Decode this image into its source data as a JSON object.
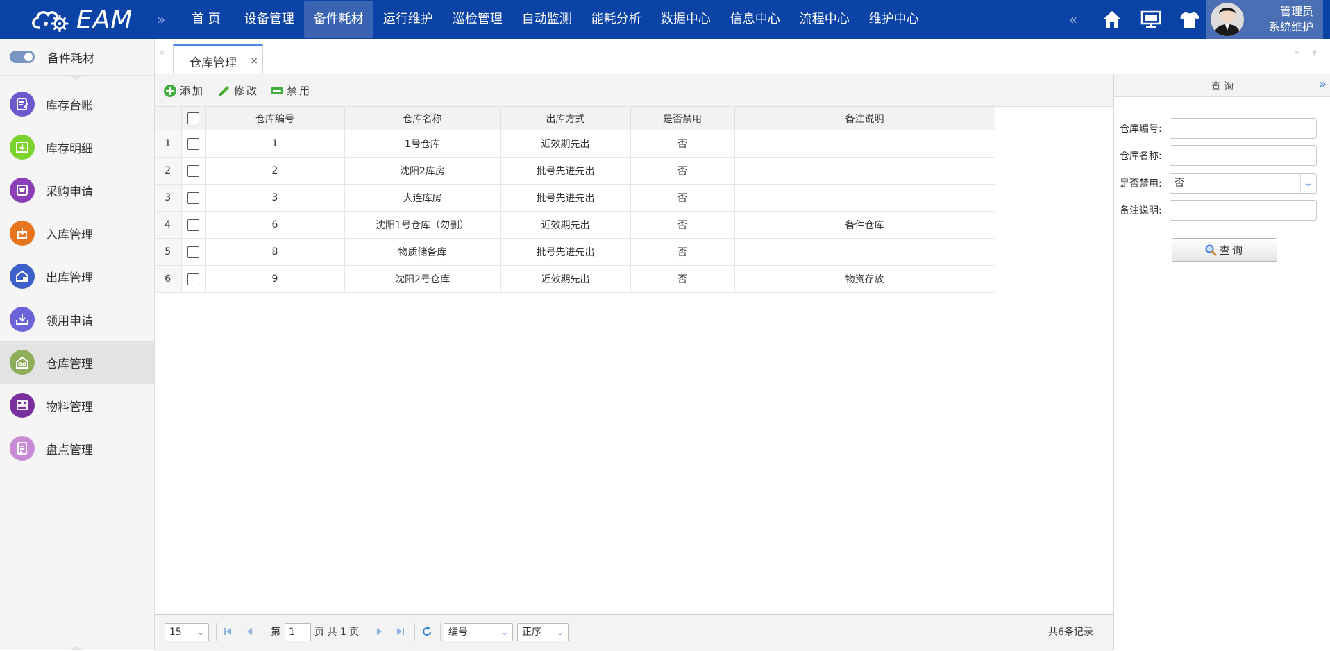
{
  "app": {
    "logo_text": "EAM"
  },
  "nav": {
    "items": [
      {
        "label": "首 页"
      },
      {
        "label": "设备管理"
      },
      {
        "label": "备件耗材",
        "active": true
      },
      {
        "label": "运行维护"
      },
      {
        "label": "巡检管理"
      },
      {
        "label": "自动监测"
      },
      {
        "label": "能耗分析"
      },
      {
        "label": "数据中心"
      },
      {
        "label": "信息中心"
      },
      {
        "label": "流程中心"
      },
      {
        "label": "维护中心"
      }
    ],
    "icons": [
      "home-icon",
      "monitor-icon",
      "tshirt-icon"
    ]
  },
  "user": {
    "name": "管理员",
    "role": "系统维护"
  },
  "sidebar": {
    "title": "备件耗材",
    "items": [
      {
        "label": "库存台账",
        "icon": "ledger-icon",
        "color": "#6a5acd"
      },
      {
        "label": "库存明细",
        "icon": "inventory-detail-icon",
        "color": "#7cd32e"
      },
      {
        "label": "采购申请",
        "icon": "purchase-icon",
        "color": "#8a3fb8"
      },
      {
        "label": "入库管理",
        "icon": "stock-in-icon",
        "color": "#e8741e"
      },
      {
        "label": "出库管理",
        "icon": "stock-out-icon",
        "color": "#3d5fc9"
      },
      {
        "label": "领用申请",
        "icon": "requisition-icon",
        "color": "#6c63d8"
      },
      {
        "label": "仓库管理",
        "icon": "warehouse-icon",
        "color": "#8fae5a",
        "active": true
      },
      {
        "label": "物料管理",
        "icon": "material-icon",
        "color": "#7a2f9e"
      },
      {
        "label": "盘点管理",
        "icon": "stocktake-icon",
        "color": "#c98ad6"
      }
    ]
  },
  "tabs": [
    {
      "label": "仓库管理",
      "close": "×"
    }
  ],
  "toolbar": {
    "add": "添加",
    "edit": "修改",
    "disable": "禁用"
  },
  "grid": {
    "columns": [
      "仓库编号",
      "仓库名称",
      "出库方式",
      "是否禁用",
      "备注说明"
    ],
    "rows": [
      {
        "n": "1",
        "code": "1",
        "name": "1号仓库",
        "method": "近效期先出",
        "disabled": "否",
        "remark": ""
      },
      {
        "n": "2",
        "code": "2",
        "name": "沈阳2库房",
        "method": "批号先进先出",
        "disabled": "否",
        "remark": ""
      },
      {
        "n": "3",
        "code": "3",
        "name": "大连库房",
        "method": "批号先进先出",
        "disabled": "否",
        "remark": ""
      },
      {
        "n": "4",
        "code": "6",
        "name": "沈阳1号仓库（勿删）",
        "method": "近效期先出",
        "disabled": "否",
        "remark": "备件仓库"
      },
      {
        "n": "5",
        "code": "8",
        "name": "物质储备库",
        "method": "批号先进先出",
        "disabled": "否",
        "remark": ""
      },
      {
        "n": "6",
        "code": "9",
        "name": "沈阳2号仓库",
        "method": "近效期先出",
        "disabled": "否",
        "remark": "物资存放"
      }
    ]
  },
  "pager": {
    "page_size": "15",
    "page_prefix": "第",
    "page": "1",
    "page_suffix": "页 共 1 页",
    "sort_field": "编号",
    "sort_order": "正序",
    "total": "共6条记录"
  },
  "query": {
    "title": "查询",
    "fields": [
      {
        "label": "仓库编号:",
        "value": ""
      },
      {
        "label": "仓库名称:",
        "value": ""
      },
      {
        "label": "是否禁用:",
        "value": "否"
      },
      {
        "label": "备注说明:",
        "value": ""
      }
    ],
    "button": "查询"
  }
}
